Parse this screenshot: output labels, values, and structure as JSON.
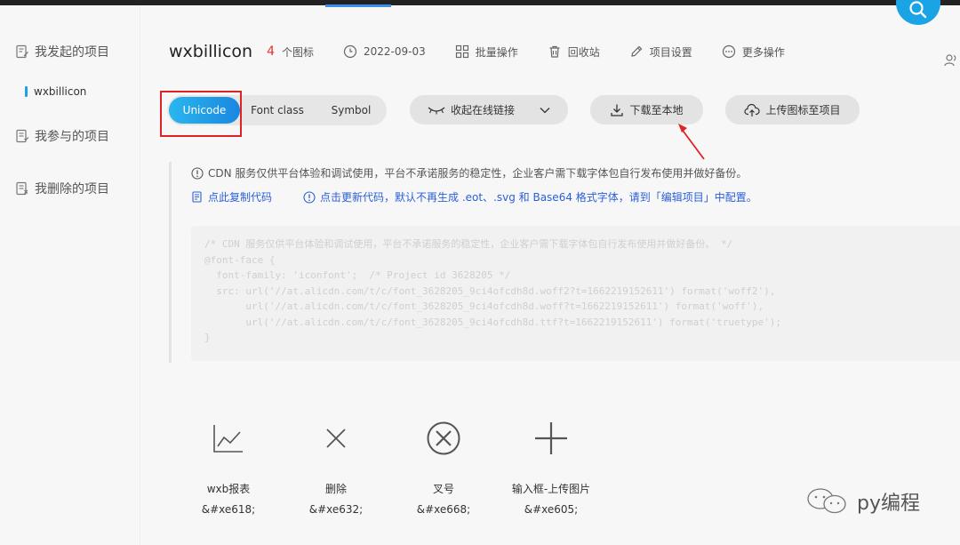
{
  "sidebar": {
    "my_projects": "我发起的项目",
    "current_project": "wxbillicon",
    "joined_projects": "我参与的项目",
    "deleted_projects": "我删除的项目"
  },
  "header": {
    "project_name": "wxbillicon",
    "icon_count": "4",
    "icon_count_label": "个图标",
    "date": "2022-09-03",
    "batch_ops": "批量操作",
    "recycle_bin": "回收站",
    "project_settings": "项目设置",
    "more_ops": "更多操作"
  },
  "tabs": {
    "unicode": "Unicode",
    "font_class": "Font class",
    "symbol": "Symbol",
    "active": "Unicode"
  },
  "actions": {
    "collapse_link": "收起在线链接",
    "download_local": "下载至本地",
    "upload_icons": "上传图标至项目"
  },
  "notices": {
    "cdn_notice": "CDN 服务仅供平台体验和调试使用，平台不承诺服务的稳定性，企业客户需下载字体包自行发布使用并做好备份。",
    "copy_code": "点此复制代码",
    "update_code": "点击更新代码，默认不再生成 .eot、.svg 和 Base64 格式字体，请到「编辑项目」中配置。"
  },
  "code": {
    "line1": "/* CDN 服务仅供平台体验和调试使用，平台不承诺服务的稳定性，企业客户需下载字体包自行发布使用并做好备份。 */",
    "line2": "@font-face {",
    "line3": "  font-family: 'iconfont';  /* Project id 3628205 */",
    "line4": "  src: url('//at.alicdn.com/t/c/font_3628205_9ci4ofcdh8d.woff2?t=1662219152611') format('woff2'),",
    "line5": "       url('//at.alicdn.com/t/c/font_3628205_9ci4ofcdh8d.woff?t=1662219152611') format('woff'),",
    "line6": "       url('//at.alicdn.com/t/c/font_3628205_9ci4ofcdh8d.ttf?t=1662219152611') format('truetype');",
    "line7": "}"
  },
  "icons": [
    {
      "name": "wxb报表",
      "code": "&#xe618;",
      "icon": "chart-icon"
    },
    {
      "name": "删除",
      "code": "&#xe632;",
      "icon": "close-icon"
    },
    {
      "name": "叉号",
      "code": "&#xe668;",
      "icon": "circle-close-icon"
    },
    {
      "name": "输入框-上传图片",
      "code": "&#xe605;",
      "icon": "plus-icon"
    }
  ],
  "watermark": "py编程",
  "colors": {
    "accent": "#1aa4e6",
    "count_red": "#e0332e",
    "link_blue": "#2b5fd9",
    "highlight_red": "#e02222"
  }
}
